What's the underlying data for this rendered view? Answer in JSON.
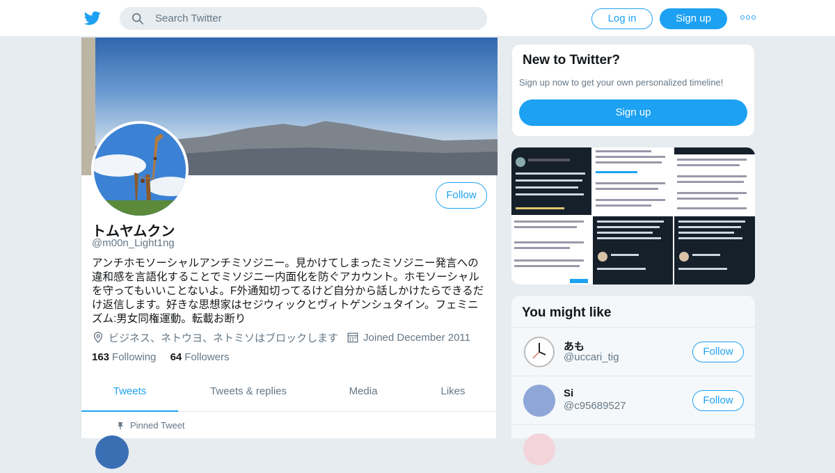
{
  "colors": {
    "accent": "#1da1f2",
    "muted": "#657786",
    "background": "#e6ecf0"
  },
  "nav": {
    "logo_icon": "twitter-bird-icon",
    "search_placeholder": "Search Twitter",
    "login_label": "Log in",
    "signup_label": "Sign up",
    "more_icon": "more-dots-icon"
  },
  "profile": {
    "name": "トムヤムクン",
    "handle": "@m00n_Light1ng",
    "follow_label": "Follow",
    "bio": "アンチホモソーシャルアンチミソジニー。見かけてしまったミソジニー発言への違和感を言語化することでミソジニー内面化を防ぐアカウント。ホモソーシャルを守ってもいいことないよ。F外通知切ってるけど自分から話しかけたらできるだけ返信します。好きな思想家はセジウィックとヴィトゲンシュタイン。フェミニズム:男女同権運動。転載お断り",
    "location": "ビジネス、ネトウヨ、ネトミソはブロックします",
    "joined": "Joined December 2011",
    "following_count": "163",
    "following_label": "Following",
    "followers_count": "64",
    "followers_label": "Followers",
    "tabs": [
      {
        "label": "Tweets"
      },
      {
        "label": "Tweets & replies"
      },
      {
        "label": "Media"
      },
      {
        "label": "Likes"
      }
    ],
    "pinned_label": "Pinned Tweet"
  },
  "new_to_twitter": {
    "title": "New to Twitter?",
    "subtitle": "Sign up now to get your own personalized timeline!",
    "signup_label": "Sign up"
  },
  "you_might_like": {
    "title": "You might like",
    "follow_label": "Follow",
    "accounts": [
      {
        "name": "あも",
        "handle": "@uccari_tig",
        "avatar": "clock-avatar"
      },
      {
        "name": "Si",
        "handle": "@c95689527",
        "avatar": "blue-circle-avatar",
        "avatar_color": "#8ea6d8"
      }
    ]
  }
}
